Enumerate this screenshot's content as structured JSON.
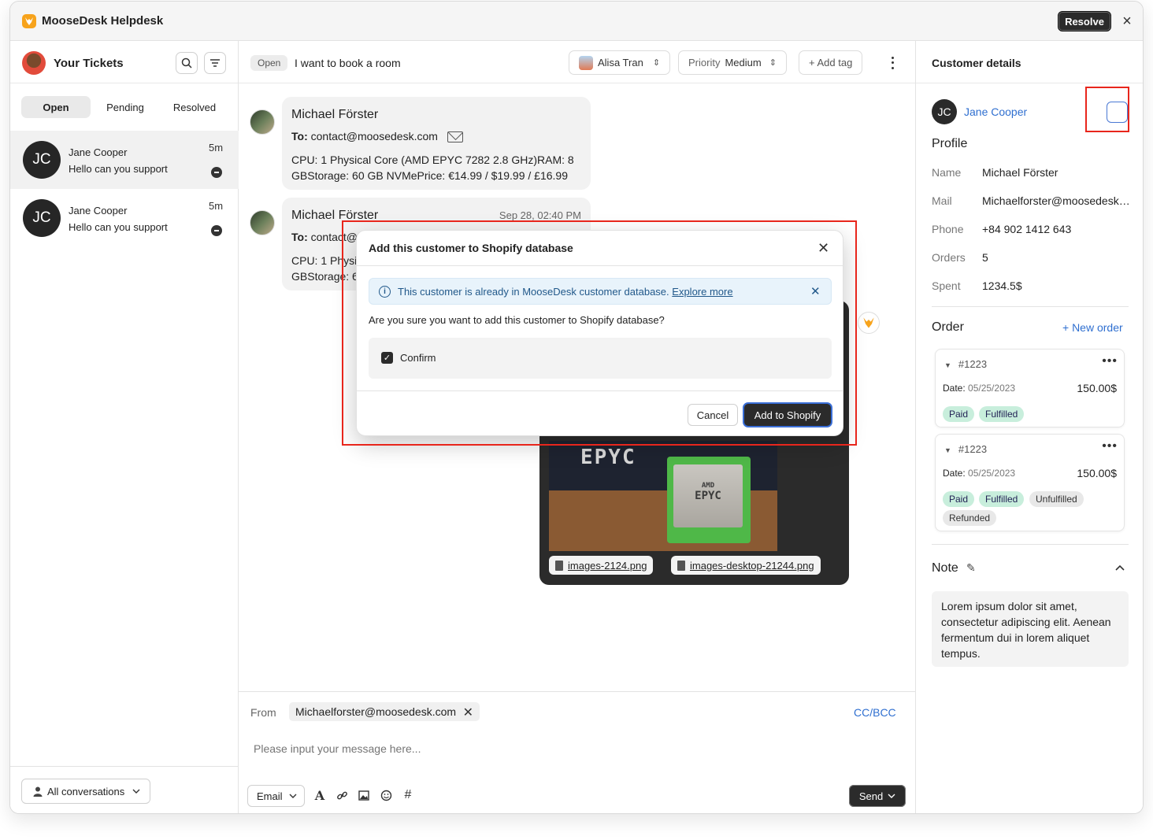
{
  "app": {
    "title": "MooseDesk Helpdesk",
    "resolve_label": "Resolve",
    "close_glyph": "×"
  },
  "sidebar": {
    "title": "Your Tickets",
    "tabs": [
      {
        "label": "Open"
      },
      {
        "label": "Pending"
      },
      {
        "label": "Resolved"
      }
    ],
    "tickets": [
      {
        "initials": "JC",
        "name": "Jane Cooper",
        "message": "Hello can you support",
        "time": "5m"
      },
      {
        "initials": "JC",
        "name": "Jane Cooper",
        "message": "Hello can you support",
        "time": "5m"
      }
    ],
    "footer_filter": "All conversations"
  },
  "ticket": {
    "status": "Open",
    "subject": "I want to book a room",
    "assignee": "Alisa Tran",
    "priority_label": "Priority",
    "priority_value": "Medium",
    "add_tag": "+ Add tag"
  },
  "messages": [
    {
      "sender": "Michael Förster",
      "to_label": "To:",
      "to": "contact@moosedesk.com",
      "body_line1": "CPU: 1 Physical Core (AMD EPYC 7282 2.8 GHz)RAM: 8",
      "body_line2": "GBStorage: 60 GB NVMePrice: €14.99 / $19.99 / £16.99"
    },
    {
      "sender": "Michael Förster",
      "time": "Sep 28, 02:40 PM",
      "to_label": "To:",
      "to_partial": "contact@",
      "body_line1": "CPU: 1 Physi",
      "body_line2": "GBStorage: 6"
    }
  ],
  "image_card": {
    "box_text": "EPYC",
    "chip_brand": "AMD",
    "chip_text": "EPYC",
    "attachments": [
      "images-2124.png",
      "images-desktop-21244.png"
    ]
  },
  "composer": {
    "from_label": "From",
    "from_value": "Michaelforster@moosedesk.com",
    "cc_bcc": "CC/BCC",
    "placeholder": "Please input your message here...",
    "channel": "Email",
    "send_label": "Send"
  },
  "customer": {
    "panel_title": "Customer details",
    "initials": "JC",
    "name": "Jane Cooper",
    "profile_title": "Profile",
    "profile": [
      {
        "key": "Name",
        "value": "Michael Förster"
      },
      {
        "key": "Mail",
        "value": "Michaelforster@moosedesk.com"
      },
      {
        "key": "Phone",
        "value": "+84 902 1412 643"
      },
      {
        "key": "Orders",
        "value": "5"
      },
      {
        "key": "Spent",
        "value": "1234.5$"
      }
    ],
    "order_title": "Order",
    "new_order": "+ New order",
    "orders": [
      {
        "id": "#1223",
        "date_label": "Date:",
        "date": "05/25/2023",
        "amount": "150.00$",
        "tags": [
          "Paid",
          "Fulfilled"
        ]
      },
      {
        "id": "#1223",
        "date_label": "Date:",
        "date": "05/25/2023",
        "amount": "150.00$",
        "tags": [
          "Paid",
          "Fulfilled",
          "Unfulfilled",
          "Refunded"
        ]
      }
    ],
    "note_title": "Note",
    "note_text": "Lorem ipsum dolor sit amet, consectetur adipiscing elit. Aenean fermentum dui in lorem aliquet tempus."
  },
  "modal": {
    "title": "Add this customer to Shopify database",
    "banner_text": "This customer is already in MooseDesk customer database.",
    "banner_link": "Explore more",
    "question": "Are you sure you want to add this customer to Shopify database?",
    "confirm_label": "Confirm",
    "confirm_checked": true,
    "cancel_label": "Cancel",
    "primary_label": "Add to Shopify"
  },
  "colors": {
    "accent": "#2f6fd0",
    "highlight": "#e8261c",
    "dark_button": "#2b2b2b",
    "paid_tag": "#c8eedc"
  }
}
